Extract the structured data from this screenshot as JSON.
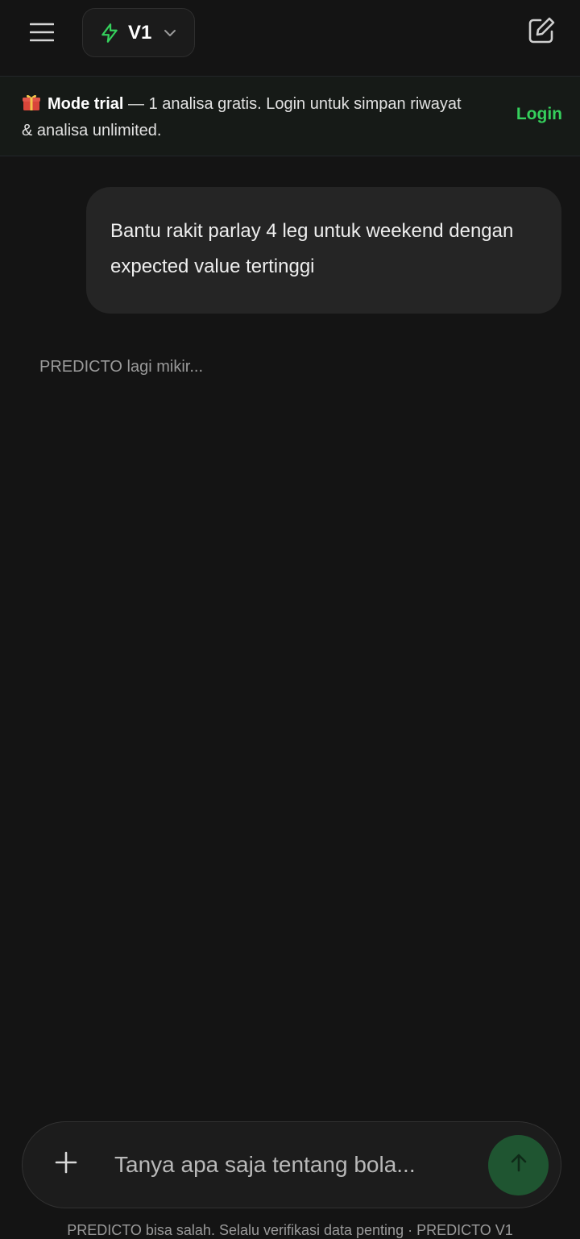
{
  "header": {
    "model_label": "V1",
    "icons": {
      "menu": "hamburger-menu-icon",
      "model": "lightning-bolt-icon",
      "model_chevron": "chevron-down-icon",
      "new_chat": "edit-square-icon"
    }
  },
  "banner": {
    "icon": "gift-icon",
    "strong": "Mode trial",
    "text": " — 1 analisa gratis. Login untuk simpan riwayat & analisa unlimited.",
    "login_label": "Login"
  },
  "chat": {
    "user_message": "Bantu rakit parlay 4 leg untuk weekend dengan expected value tertinggi",
    "status": "PREDICTO lagi mikir..."
  },
  "composer": {
    "placeholder": "Tanya apa saja tentang bola...",
    "value": "",
    "icons": {
      "attach": "plus-icon",
      "send": "arrow-up-icon"
    }
  },
  "footer": {
    "disclaimer": "PREDICTO bisa salah. Selalu verifikasi data penting · PREDICTO V1"
  },
  "colors": {
    "background": "#141414",
    "accent_green": "#35d05c",
    "send_button": "#1f5531",
    "bubble": "#252525"
  }
}
